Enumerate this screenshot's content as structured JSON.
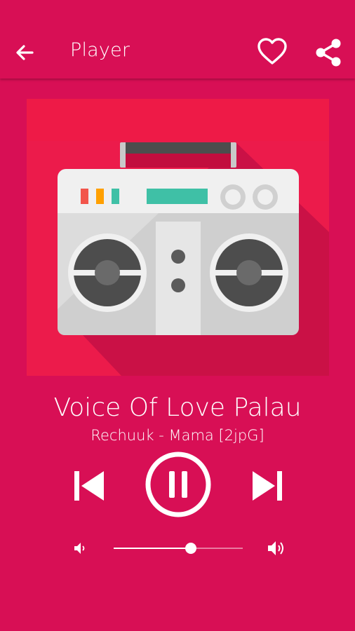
{
  "header": {
    "title": "Player",
    "icons": {
      "back": "arrow-left-icon",
      "favorite": "heart-outline-icon",
      "share": "share-icon"
    }
  },
  "artwork": {
    "icon": "boombox-radio-icon"
  },
  "track": {
    "title": "Voice Of Love Palau",
    "artist": "Rechuuk - Mama [2jpG]"
  },
  "controls": {
    "previous_icon": "skip-previous-icon",
    "pause_icon": "pause-circle-icon",
    "next_icon": "skip-next-icon"
  },
  "volume": {
    "level": 0.6,
    "low_icon": "volume-low-icon",
    "high_icon": "volume-high-icon"
  },
  "colors": {
    "background": "#d80f55",
    "art_background": "#ec1b4b",
    "boombox_body": "#e0e0e0",
    "accent_teal": "#3fc0a6",
    "accent_orange": "#ffa000",
    "accent_red": "#f2554b"
  }
}
